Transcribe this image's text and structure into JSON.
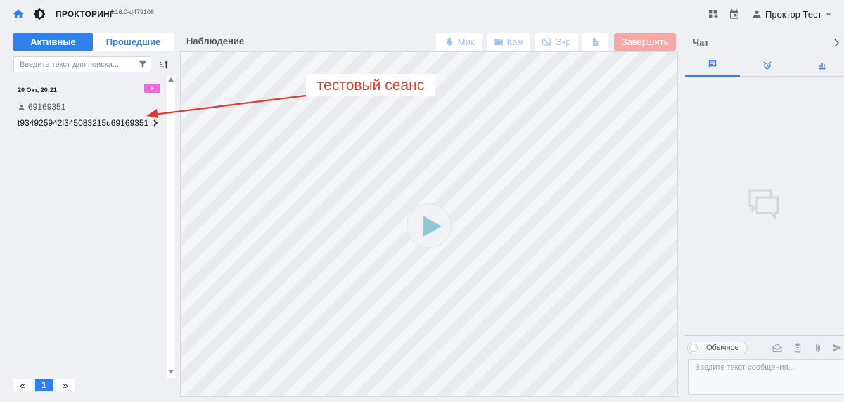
{
  "header": {
    "title": "ПРОКТОРИНГ",
    "version": "4.16.0-d479108",
    "user_name": "Проктор Тест",
    "icons": [
      "home-icon",
      "theme-icon",
      "apps-add-icon",
      "calendar-icon",
      "user-icon",
      "chevron-down-icon"
    ]
  },
  "sessions_panel": {
    "tabs": [
      {
        "label": "Активные",
        "active": true
      },
      {
        "label": "Прошедшие",
        "active": false
      }
    ],
    "search": {
      "placeholder": "Введите текст для поиска...",
      "value": ""
    },
    "items": [
      {
        "date": "20 Окт, 20:21",
        "user_id": "69169351",
        "code": "t934925942l345083215u69169351"
      }
    ],
    "pagination": {
      "first": "«",
      "current": "1",
      "last": "»"
    }
  },
  "observation": {
    "title": "Наблюдение",
    "controls": {
      "mic": "Мик",
      "cam": "Кам",
      "screen": "Экр",
      "finish": "Завершить"
    }
  },
  "annotation": {
    "text": "тестовый сеанс",
    "color": "#e03a2e"
  },
  "chat": {
    "title": "Чат",
    "mode_label": "Обычное",
    "message_placeholder": "Введите текст сообщения..."
  },
  "colors": {
    "primary": "#2f80ed",
    "badge": "#f466d9",
    "finish_button": "#f5a8a8",
    "control_text": "#9fc3ee"
  }
}
